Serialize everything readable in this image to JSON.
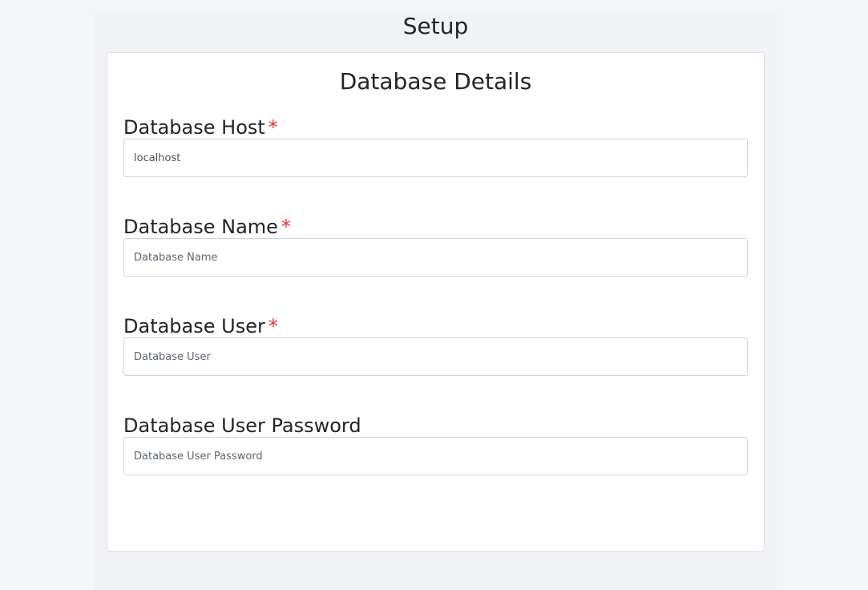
{
  "page": {
    "title": "Setup"
  },
  "card": {
    "title": "Database Details"
  },
  "fields": [
    {
      "label": "Database Host",
      "required_marker": "*",
      "value": "localhost",
      "placeholder": ""
    },
    {
      "label": "Database Name",
      "required_marker": "*",
      "value": "",
      "placeholder": "Database Name"
    },
    {
      "label": "Database User",
      "required_marker": "*",
      "value": "",
      "placeholder": "Database User"
    },
    {
      "label": "Database User Password",
      "value": "",
      "placeholder": "Database User Password"
    }
  ],
  "colors": {
    "background": "#f4f6f9",
    "panel": "#f1f2f5",
    "card": "#ffffff",
    "required": "#e3342f",
    "text": "#212529"
  }
}
